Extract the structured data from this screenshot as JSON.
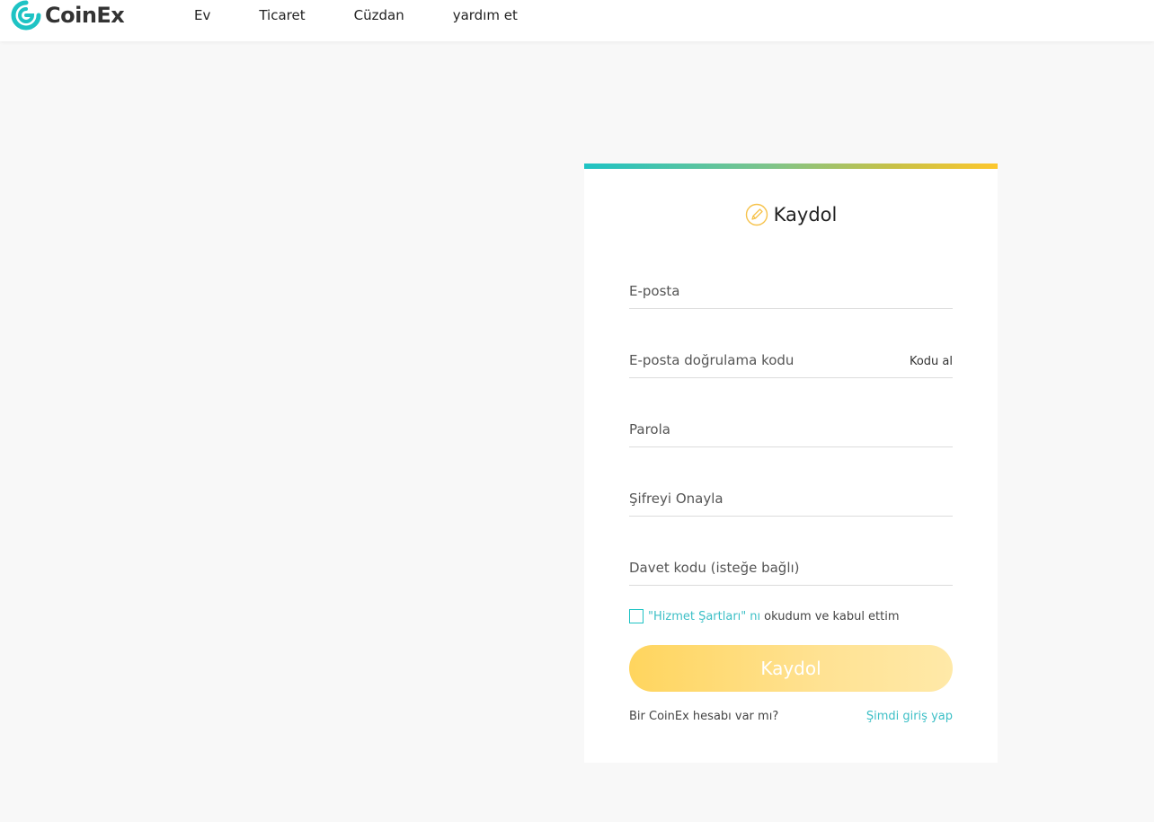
{
  "brand": {
    "name": "CoinEx",
    "primary_color": "#1ec3c4",
    "accent_color": "#fdc72d"
  },
  "nav": {
    "items": [
      {
        "label": "Ev"
      },
      {
        "label": "Ticaret"
      },
      {
        "label": "Cüzdan"
      },
      {
        "label": "yardım et"
      }
    ]
  },
  "signup": {
    "title": "Kaydol",
    "title_icon": "pencil-icon",
    "fields": {
      "email": {
        "placeholder": "E-posta",
        "value": ""
      },
      "email_code": {
        "placeholder": "E-posta doğrulama kodu",
        "value": "",
        "action_label": "Kodu al"
      },
      "password": {
        "placeholder": "Parola",
        "value": ""
      },
      "confirm_password": {
        "placeholder": "Şifreyi Onayla",
        "value": ""
      },
      "invite_code": {
        "placeholder": "Davet kodu (isteğe bağlı)",
        "value": ""
      }
    },
    "terms": {
      "checked": false,
      "link_text": "\"Hizmet Şartları\"",
      "suffix": "nı",
      "text": "okudum ve kabul ettim"
    },
    "submit_label": "Kaydol",
    "footer": {
      "question": "Bir CoinEx hesabı var mı?",
      "login_link": "Şimdi giriş yap"
    }
  }
}
